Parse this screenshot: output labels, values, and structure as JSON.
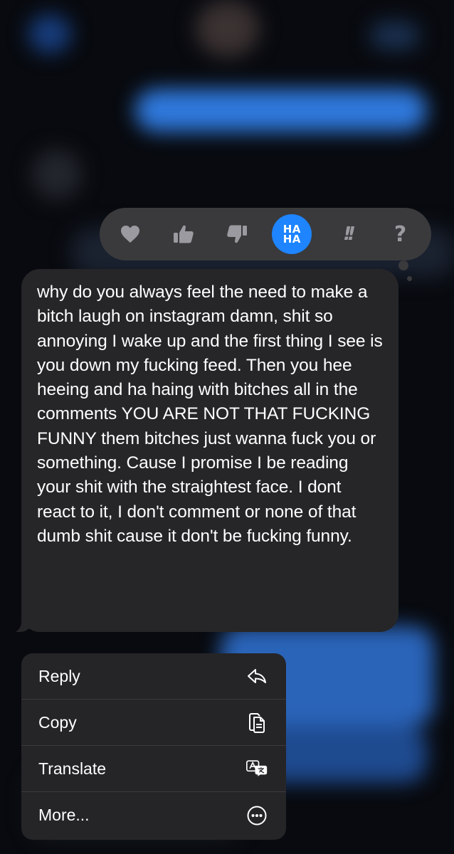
{
  "reactions": [
    {
      "name": "heart",
      "selected": false
    },
    {
      "name": "thumbs-up",
      "selected": false
    },
    {
      "name": "thumbs-down",
      "selected": false
    },
    {
      "name": "haha",
      "selected": true,
      "line1": "HA",
      "line2": "HA"
    },
    {
      "name": "exclamation",
      "selected": false,
      "glyph": "!!"
    },
    {
      "name": "question",
      "selected": false,
      "glyph": "?"
    }
  ],
  "message": {
    "text": "why do you always feel the need to make a bitch laugh on instagram damn, shit so annoying I wake up and the first thing I see is you down my fucking feed. Then you hee heeing and ha haing with bitches all in the comments YOU ARE NOT THAT FUCKING FUNNY them bitches just wanna fuck you or something. Cause I promise I be reading your shit with the straightest face. I dont react to it, I don't comment or none of that dumb shit cause it don't be fucking funny."
  },
  "menu": {
    "items": [
      {
        "label": "Reply",
        "icon": "reply-icon"
      },
      {
        "label": "Copy",
        "icon": "copy-icon"
      },
      {
        "label": "Translate",
        "icon": "translate-icon"
      },
      {
        "label": "More...",
        "icon": "more-icon"
      }
    ]
  },
  "colors": {
    "accent": "#1e84ff",
    "bubble": "#262628",
    "menu": "#252527",
    "reaction_bar": "#3a3a3c"
  }
}
